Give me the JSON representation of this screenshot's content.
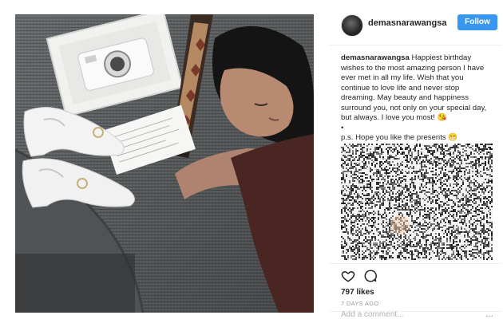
{
  "post": {
    "username": "demasnarawangsa",
    "follow_label": "Follow",
    "caption_user": "demasnarawangsa",
    "caption_lines": [
      " Happiest birthday",
      "wishes to the most amazing person I have",
      "ever met in all my life. Wish that you",
      "continue to love life and never stop",
      "dreaming. May beauty and happiness",
      "surround you, not only on your special day,",
      "but always. I love you most! 😘",
      "•",
      "p.s. Hope you like the presents 😁"
    ],
    "likes": "797 likes",
    "time": "7 DAYS AGO",
    "comment_placeholder": "Add a comment...",
    "more_label": "..."
  },
  "icons": {
    "like": "heart-icon",
    "comment": "comment-bubble-icon",
    "more": "more-options-icon"
  },
  "colors": {
    "follow_button": "#3897f0",
    "muted_text": "#999999"
  }
}
